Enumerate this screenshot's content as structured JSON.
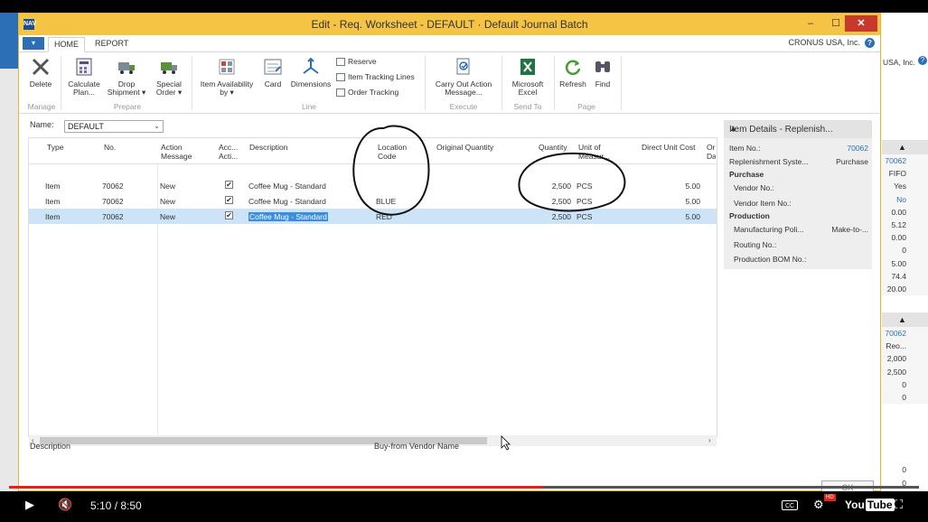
{
  "window": {
    "title": "Edit - Req. Worksheet - DEFAULT · Default Journal Batch",
    "company": "CRONUS USA, Inc.",
    "logo": "NAV",
    "minimize": "–",
    "maximize": "☐",
    "close": "✕"
  },
  "ribbon": {
    "app_menu": "▾",
    "tabs": [
      "HOME",
      "REPORT"
    ],
    "buttons": {
      "delete": "Delete",
      "calculate_plan": "Calculate Plan...",
      "drop_shipment": "Drop Shipment ▾",
      "special_order": "Special Order ▾",
      "item_availability": "Item Availability by ▾",
      "card": "Card",
      "dimensions": "Dimensions",
      "reserve": "Reserve",
      "item_tracking_lines": "Item Tracking Lines",
      "order_tracking": "Order Tracking",
      "carry_out": "Carry Out Action Message...",
      "microsoft_excel": "Microsoft Excel",
      "refresh": "Refresh",
      "find": "Find"
    },
    "groups": {
      "manage": "Manage",
      "prepare": "Prepare",
      "line": "Line",
      "execute": "Execute",
      "send_to": "Send To",
      "page": "Page"
    }
  },
  "batch": {
    "name_label": "Name:",
    "name_value": "DEFAULT"
  },
  "grid": {
    "headers": {
      "type": "Type",
      "no": "No.",
      "action_message": "Action Message",
      "accept_action": "Acc... Acti...",
      "description": "Description",
      "location_code": "Location Code",
      "original_quantity": "Original Quantity",
      "quantity": "Quantity",
      "unit_of_measure": "Unit of Measur...",
      "direct_unit_cost": "Direct Unit Cost",
      "order_date": "Or Da"
    },
    "rows": [
      {
        "type": "Item",
        "no": "70062",
        "action": "New",
        "accept": "✔",
        "description": "Coffee Mug - Standard",
        "location": "",
        "quantity": "2,500",
        "uom": "PCS",
        "cost": "5.00"
      },
      {
        "type": "Item",
        "no": "70062",
        "action": "New",
        "accept": "✔",
        "description": "Coffee Mug - Standard",
        "location": "BLUE",
        "quantity": "2,500",
        "uom": "PCS",
        "cost": "5.00"
      },
      {
        "type": "Item",
        "no": "70062",
        "action": "New",
        "accept": "✔",
        "description": "Coffee Mug - Standard",
        "location": "RED",
        "quantity": "2,500",
        "uom": "PCS",
        "cost": "5.00"
      }
    ]
  },
  "footer": {
    "description_label": "Description",
    "vendor_name_label": "Buy-from Vendor Name",
    "ok": "OK"
  },
  "factbox": {
    "title": "Item Details - Replenish...",
    "item_no_label": "Item No.:",
    "item_no_value": "70062",
    "replenishment_label": "Replenishment Syste...",
    "replenishment_value": "Purchase",
    "purchase_section": "Purchase",
    "vendor_no_label": "Vendor No.:",
    "vendor_item_no_label": "Vendor Item No.:",
    "production_section": "Production",
    "manufacturing_policy_label": "Manufacturing Poli...",
    "manufacturing_policy_value": "Make-to-...",
    "routing_no_label": "Routing No.:",
    "production_bom_label": "Production BOM No.:"
  },
  "background": {
    "company_partial": "USA, Inc.",
    "factbox1": [
      "70062",
      "FIFO",
      "Yes",
      "No",
      "0.00",
      "5.12",
      "0.00",
      "0",
      "5.00",
      "74.4",
      "20.00"
    ],
    "factbox2": [
      "70062",
      "Reo...",
      "2,000",
      "2,500",
      "0",
      "0"
    ],
    "bottom_values": [
      "0",
      "0"
    ]
  },
  "player": {
    "time": "5:10 / 8:50",
    "progress": 0.587,
    "cc": "CC",
    "hd": "HD",
    "youtube": "You",
    "youtube_tube": "Tube"
  }
}
